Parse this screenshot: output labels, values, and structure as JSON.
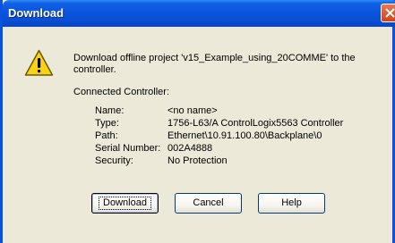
{
  "window": {
    "title": "Download"
  },
  "message": "Download offline project 'v15_Example_using_20COMME' to the controller.",
  "connected_label": "Connected Controller:",
  "controller": [
    {
      "key": "Name:",
      "value": "<no name>"
    },
    {
      "key": "Type:",
      "value": "1756-L63/A ControlLogix5563 Controller"
    },
    {
      "key": "Path:",
      "value": "Ethernet\\10.91.100.80\\Backplane\\0"
    },
    {
      "key": "Serial Number:",
      "value": "002A4888"
    },
    {
      "key": "Security:",
      "value": "No Protection"
    }
  ],
  "buttons": {
    "download": "Download",
    "cancel": "Cancel",
    "help": "Help"
  },
  "icons": {
    "close": "close-icon",
    "warning": "warning-icon"
  },
  "colors": {
    "titlebar": "#0a55dc",
    "background": "#ece9d8",
    "warning": "#f9d314"
  }
}
